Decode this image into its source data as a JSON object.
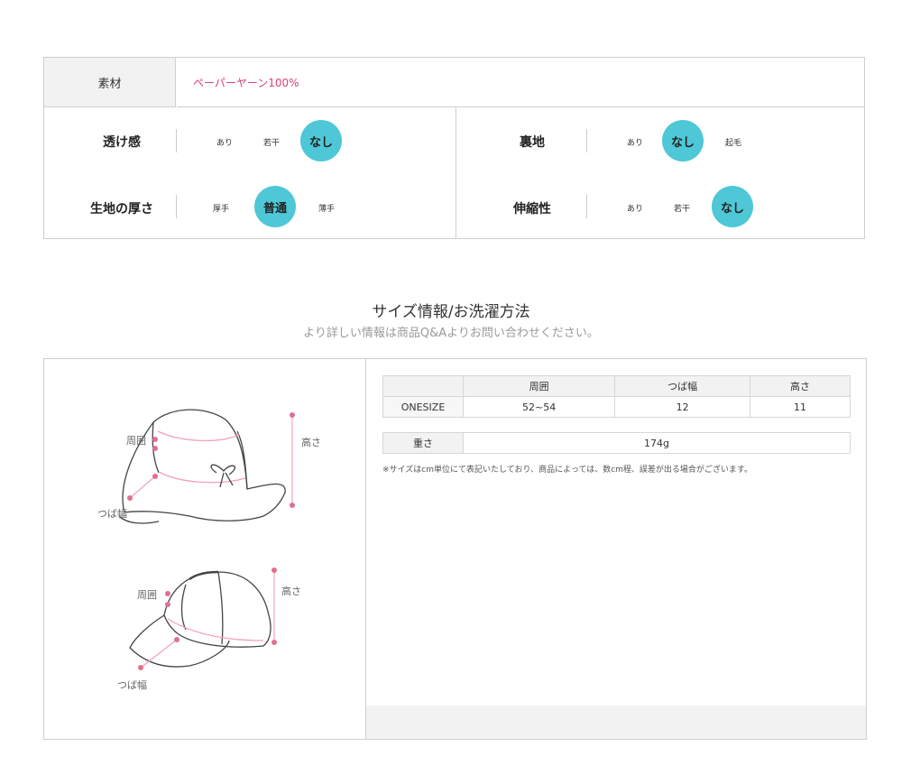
{
  "material": {
    "header": "素材",
    "value": "ペーパーヤーン100%",
    "value_color": "#d8437a"
  },
  "attributes": [
    {
      "label": "透け感",
      "options": [
        "あり",
        "若干",
        "なし"
      ],
      "selected": 2
    },
    {
      "label": "裏地",
      "options": [
        "あり",
        "なし",
        "起毛"
      ],
      "selected": 1
    },
    {
      "label": "生地の厚さ",
      "options": [
        "厚手",
        "普通",
        "薄手"
      ],
      "selected": 1
    },
    {
      "label": "伸縮性",
      "options": [
        "あり",
        "若干",
        "なし"
      ],
      "selected": 2
    }
  ],
  "accent_color": "#4ec7d6",
  "section": {
    "title": "サイズ情報/お洗濯方法",
    "subtitle": "より詳しい情報は商品Q&Aよりお問い合わせください。"
  },
  "size_table": {
    "columns": [
      "",
      "周囲",
      "つば幅",
      "高さ"
    ],
    "rows": [
      [
        "ONESIZE",
        "52~54",
        "12",
        "11"
      ]
    ]
  },
  "weight": {
    "label": "重さ",
    "value": "174g"
  },
  "note": "※サイズはcm単位にて表記いたしており、商品によっては、数cm程、誤差が出る場合がございます。",
  "diagram_labels": {
    "hat1_circ": "周囲",
    "hat1_brim": "つば幅",
    "hat1_height": "高さ",
    "hat2_circ": "周囲",
    "hat2_brim": "つば幅",
    "hat2_height": "高さ"
  }
}
